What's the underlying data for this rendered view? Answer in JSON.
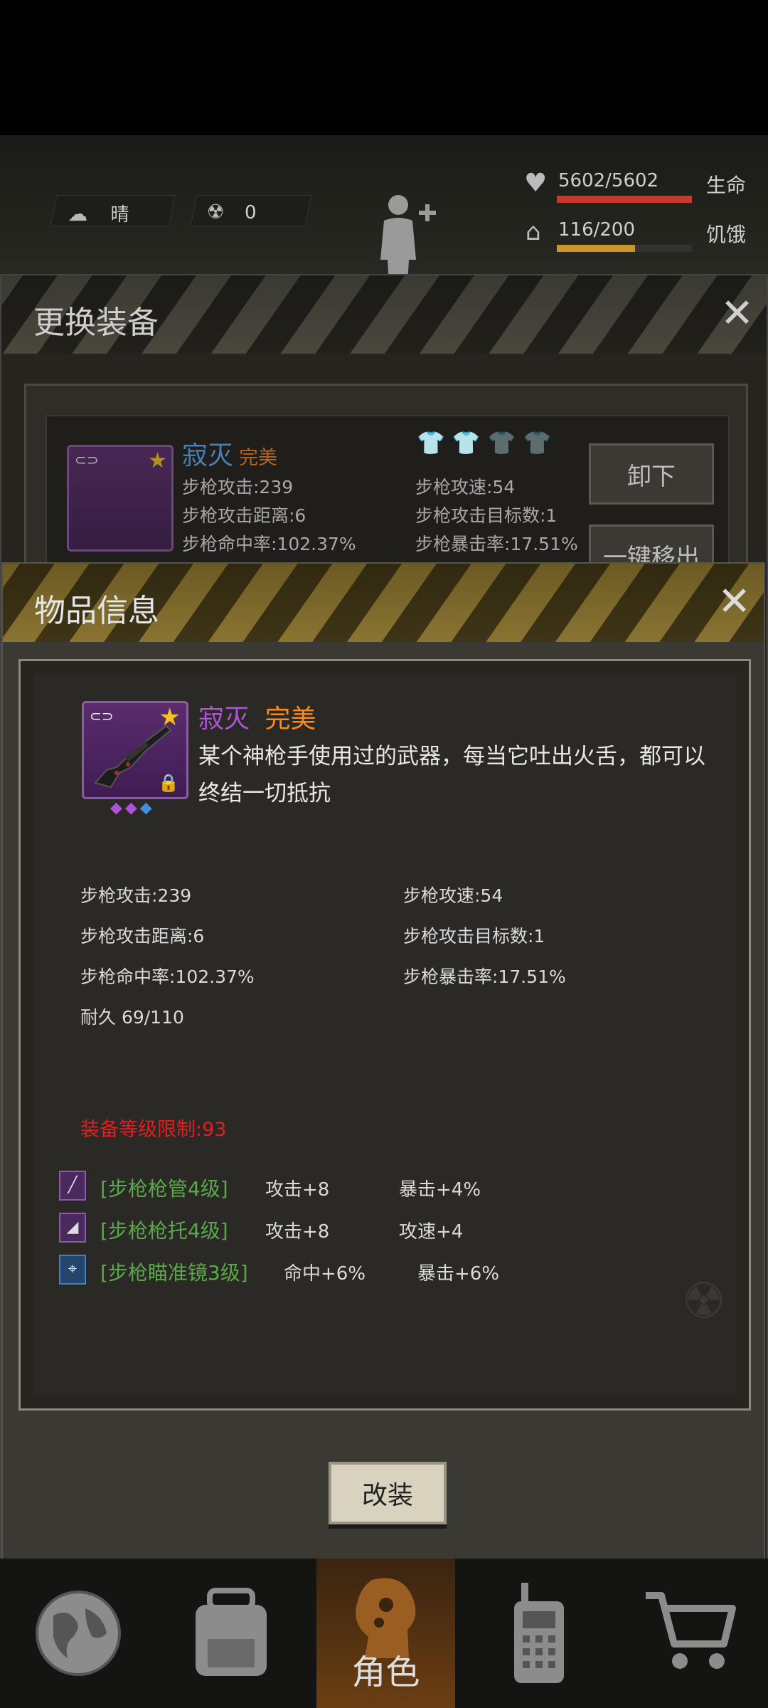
{
  "status": {
    "weather": "晴",
    "radiation": "0",
    "hp": "5602/5602",
    "hp_label": "生命",
    "hunger": "116/200",
    "hunger_label": "饥饿",
    "hp_fraction": 1.0,
    "hunger_fraction": 0.58
  },
  "equip_panel": {
    "title": "更换装备",
    "item_name": "寂灭",
    "item_quality": "完美",
    "stats_left": [
      "步枪攻击:239",
      "步枪攻击距离:6",
      "步枪命中率:102.37%"
    ],
    "stats_right": [
      "步枪攻速:54",
      "步枪攻击目标数:1",
      "步枪暴击率:17.51%"
    ],
    "unequip_label": "卸下",
    "remove_label": "一键移出"
  },
  "item_info": {
    "title": "物品信息",
    "name": "寂灭",
    "quality": "完美",
    "description": "某个神枪手使用过的武器，每当它吐出火舌，都可以终结一切抵抗",
    "stats_left": [
      "步枪攻击:239",
      "步枪攻击距离:6",
      "步枪命中率:102.37%",
      "耐久 69/110"
    ],
    "stats_right": [
      "步枪攻速:54",
      "步枪攻击目标数:1",
      "步枪暴击率:17.51%"
    ],
    "level_req": "装备等级限制:93",
    "mods": [
      {
        "name": "[步枪枪管4级]",
        "bonus1": "攻击+8",
        "bonus2": "暴击+4%"
      },
      {
        "name": "[步枪枪托4级]",
        "bonus1": "攻击+8",
        "bonus2": "攻速+4"
      },
      {
        "name": "[步枪瞄准镜3级]",
        "bonus1": "命中+6%",
        "bonus2": "暴击+6%"
      }
    ],
    "modify_label": "改装"
  },
  "nav": {
    "role_label": "角色"
  },
  "colors": {
    "hp_bar": "#c8392b",
    "hunger_bar": "#c9962b",
    "item_name": "#b052d8",
    "quality": "#ff8a1a",
    "mod_name": "#5ba84a",
    "level_req": "#e02020"
  }
}
